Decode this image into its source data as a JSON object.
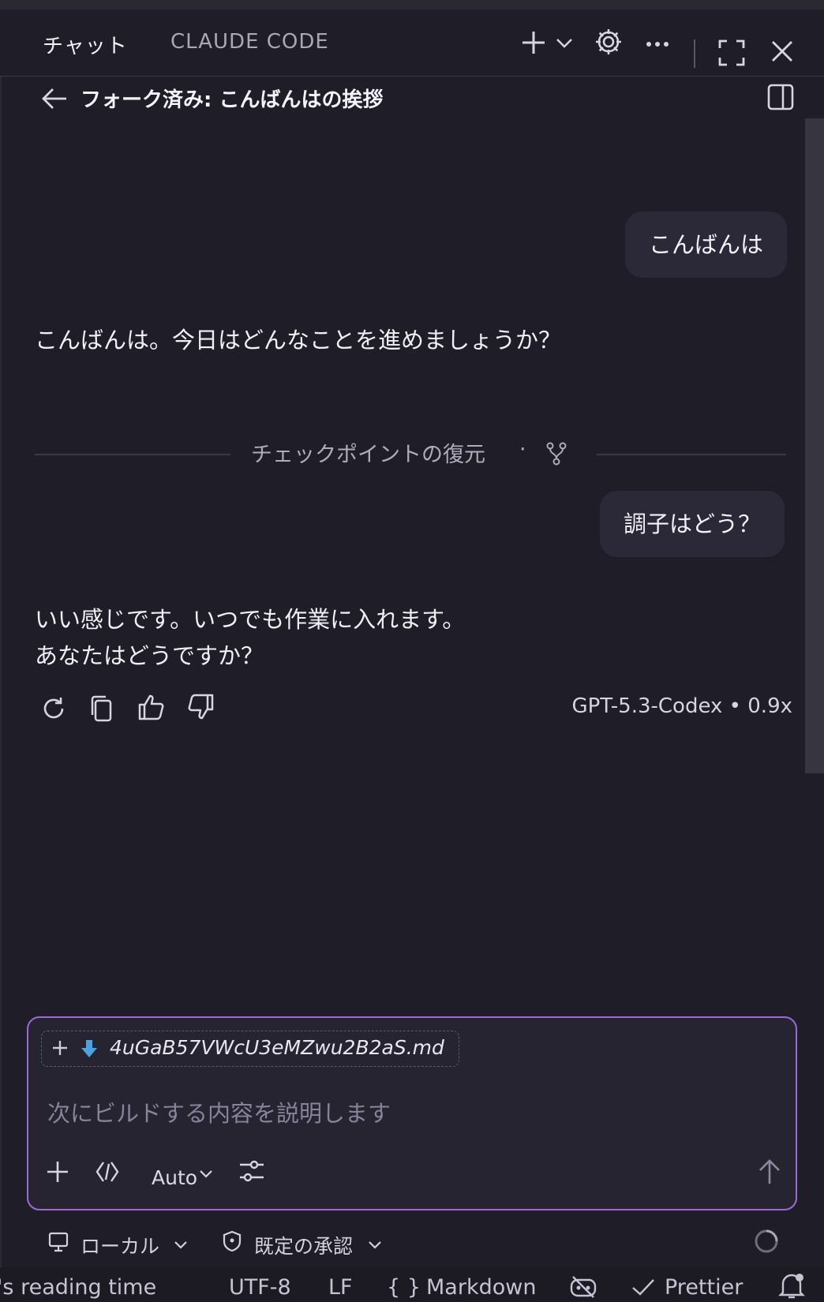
{
  "tabs": {
    "chat": "チャット",
    "claude_code": "CLAUDE CODE"
  },
  "header": {
    "title": "フォーク済み: こんばんはの挨拶"
  },
  "messages": {
    "user1": "こんばんは",
    "assistant1": "こんばんは。今日はどんなことを進めましょうか？",
    "checkpoint": "チェックポイントの復元",
    "checkpoint_dot": "·",
    "user2": "調子はどう？",
    "assistant2_line1": "いい感じです。いつでも作業に入れます。",
    "assistant2_line2": "あなたはどうですか？",
    "model_info": "GPT-5.3-Codex • 0.9x"
  },
  "input": {
    "attachment": "4uGaB57VWcU3eMZwu2B2aS.md",
    "placeholder": "次にビルドする内容を説明します",
    "mode": "Auto"
  },
  "footer": {
    "location": "ローカル",
    "approval": "既定の承認"
  },
  "statusbar": {
    "reading": "'s reading time",
    "encoding": "UTF-8",
    "eol": "LF",
    "braces": "{ }",
    "language": "Markdown",
    "prettier": "Prettier"
  },
  "colors": {
    "accent": "#9b6ad6",
    "background": "#1f1d27",
    "bubble": "#2b2937"
  }
}
